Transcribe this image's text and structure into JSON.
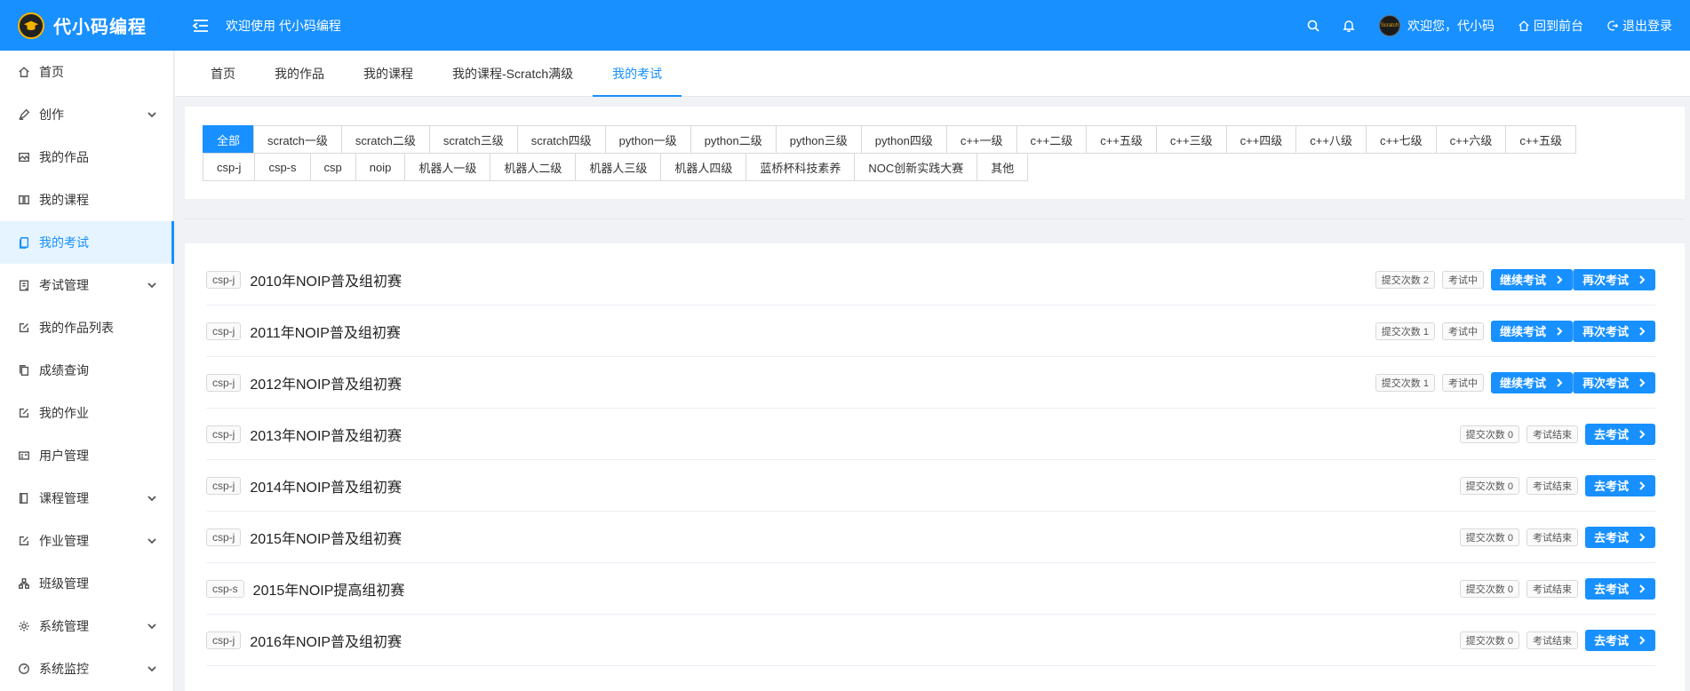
{
  "header": {
    "logo_text": "代小码编程",
    "welcome": "欢迎使用 代小码编程",
    "user_greeting": "欢迎您，代小码",
    "avatar_text": "Scratch",
    "back_link": "回到前台",
    "logout_link": "退出登录"
  },
  "sidebar": {
    "items": [
      {
        "label": "首页",
        "icon": "home-icon"
      },
      {
        "label": "创作",
        "icon": "pen-icon",
        "expandable": true
      },
      {
        "label": "我的作品",
        "icon": "image-icon"
      },
      {
        "label": "我的课程",
        "icon": "book-open-icon"
      },
      {
        "label": "我的考试",
        "icon": "document-icon",
        "active": true
      },
      {
        "label": "考试管理",
        "icon": "clipboard-icon",
        "expandable": true
      },
      {
        "label": "我的作品列表",
        "icon": "edit-icon"
      },
      {
        "label": "成绩查询",
        "icon": "copy-icon"
      },
      {
        "label": "我的作业",
        "icon": "edit-icon"
      },
      {
        "label": "用户管理",
        "icon": "id-card-icon"
      },
      {
        "label": "课程管理",
        "icon": "book-icon",
        "expandable": true
      },
      {
        "label": "作业管理",
        "icon": "edit-icon",
        "expandable": true
      },
      {
        "label": "班级管理",
        "icon": "org-icon"
      },
      {
        "label": "系统管理",
        "icon": "gear-icon",
        "expandable": true
      },
      {
        "label": "系统监控",
        "icon": "gauge-icon",
        "expandable": true
      }
    ]
  },
  "tabs": [
    "首页",
    "我的作品",
    "我的课程",
    "我的课程-Scratch满级",
    "我的考试"
  ],
  "active_tab": 4,
  "filters": {
    "row1": [
      "全部",
      "scratch一级",
      "scratch二级",
      "scratch三级",
      "scratch四级",
      "python一级",
      "python二级",
      "python三级",
      "python四级",
      "c++一级",
      "c++二级",
      "c++五级",
      "c++三级",
      "c++四级",
      "c++八级",
      "c++七级",
      "c++六级",
      "c++五级"
    ],
    "row2": [
      "csp-j",
      "csp-s",
      "csp",
      "noip",
      "机器人一级",
      "机器人二级",
      "机器人三级",
      "机器人四级",
      "蓝桥杯科技素养",
      "NOC创新实践大赛",
      "其他"
    ]
  },
  "exams": [
    {
      "tag": "csp-j",
      "title": "2010年NOIP普及组初赛",
      "submits": "提交次数 2",
      "status": "考试中",
      "buttons": [
        "继续考试",
        "再次考试"
      ]
    },
    {
      "tag": "csp-j",
      "title": "2011年NOIP普及组初赛",
      "submits": "提交次数 1",
      "status": "考试中",
      "buttons": [
        "继续考试",
        "再次考试"
      ]
    },
    {
      "tag": "csp-j",
      "title": "2012年NOIP普及组初赛",
      "submits": "提交次数 1",
      "status": "考试中",
      "buttons": [
        "继续考试",
        "再次考试"
      ]
    },
    {
      "tag": "csp-j",
      "title": "2013年NOIP普及组初赛",
      "submits": "提交次数 0",
      "status": "考试结束",
      "buttons": [
        "去考试"
      ]
    },
    {
      "tag": "csp-j",
      "title": "2014年NOIP普及组初赛",
      "submits": "提交次数 0",
      "status": "考试结束",
      "buttons": [
        "去考试"
      ]
    },
    {
      "tag": "csp-j",
      "title": "2015年NOIP普及组初赛",
      "submits": "提交次数 0",
      "status": "考试结束",
      "buttons": [
        "去考试"
      ]
    },
    {
      "tag": "csp-s",
      "title": "2015年NOIP提高组初赛",
      "submits": "提交次数 0",
      "status": "考试结束",
      "buttons": [
        "去考试"
      ]
    },
    {
      "tag": "csp-j",
      "title": "2016年NOIP普及组初赛",
      "submits": "提交次数 0",
      "status": "考试结束",
      "buttons": [
        "去考试"
      ]
    }
  ],
  "colors": {
    "primary": "#1890ff",
    "background": "#f0f2f5"
  }
}
